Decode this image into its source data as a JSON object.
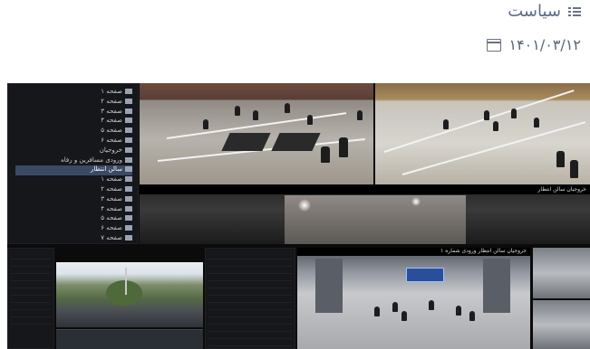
{
  "header": {
    "category_label": "سیاست",
    "category_icon": "category-list-icon",
    "date": "۱۴۰۱/۰۳/۱۲",
    "date_icon": "calendar-icon"
  },
  "screenshot": {
    "tree": {
      "items": [
        {
          "label": "صفحه ۱",
          "active": false
        },
        {
          "label": "صفحه ۲",
          "active": false
        },
        {
          "label": "صفحه ۳",
          "active": false
        },
        {
          "label": "صفحه ۴",
          "active": false
        },
        {
          "label": "صفحه ۵",
          "active": false
        },
        {
          "label": "صفحه ۶",
          "active": false
        },
        {
          "label": "خروجیان",
          "active": false
        },
        {
          "label": "ورودی مسافرین و رفاه",
          "active": false
        },
        {
          "label": "سالن انتظار",
          "active": true
        },
        {
          "label": "صفحه ۱",
          "active": false
        },
        {
          "label": "صفحه ۲",
          "active": false
        },
        {
          "label": "صفحه ۳",
          "active": false
        },
        {
          "label": "صفحه ۴",
          "active": false
        },
        {
          "label": "صفحه ۵",
          "active": false
        },
        {
          "label": "صفحه ۶",
          "active": false
        },
        {
          "label": "صفحه ۷",
          "active": false
        }
      ]
    },
    "cameras": {
      "hall_view": "",
      "station_view": "",
      "dark_view_label": "خروجیان سالن انتظار",
      "outdoor_view": "",
      "concourse_view_label": "خروجیان سالن انتظار ورودی شماره ۱",
      "side_list_label": "خروجیان"
    }
  }
}
